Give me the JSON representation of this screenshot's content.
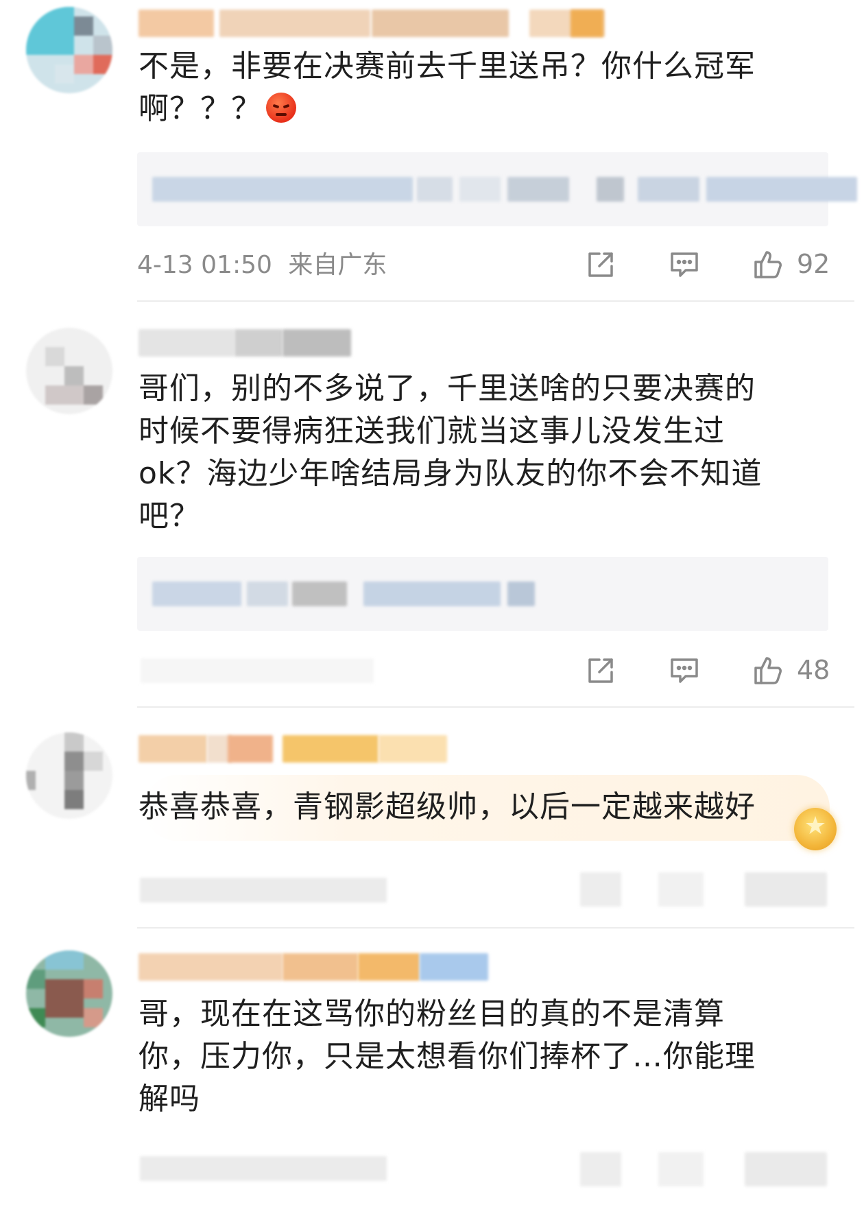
{
  "comments": [
    {
      "text_lines": [
        "不是，非要在决赛前去千里送吊？你什么冠军",
        "啊？？？"
      ],
      "emoji": "angry-face-emoji",
      "timestamp": "4-13 01:50",
      "location": "来自广东",
      "likes": "92"
    },
    {
      "text_lines": [
        "哥们，别的不多说了，千里送啥的只要决赛的",
        "时候不要得病狂送我们就当这事儿没发生过",
        "ok？海边少年啥结局身为队友的你不会不知道",
        "吧？"
      ],
      "likes": "48"
    },
    {
      "text_lines": [
        "恭喜恭喜，青钢影超级帅，以后一定越来越好"
      ]
    },
    {
      "text_lines": [
        "哥，现在在这骂你的粉丝目的真的不是清算",
        "你，压力你，只是太想看你们捧杯了…你能理",
        "解吗"
      ]
    }
  ],
  "icons": {
    "share": "share-icon",
    "comment": "comment-icon",
    "like": "thumbs-up-icon",
    "badge": "gold-star-badge-icon"
  },
  "colors": {
    "text": "#1f1f1f",
    "meta": "#8a8a8a",
    "quote_bg": "#f5f5f7",
    "divider": "#ececec"
  }
}
